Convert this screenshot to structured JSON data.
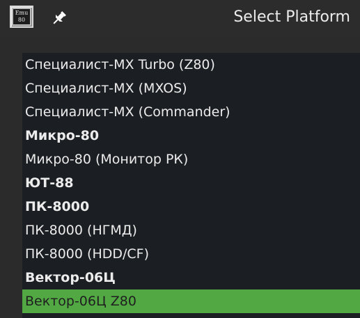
{
  "window": {
    "title": "Select Platform",
    "app_icon_text_line1": "Emu",
    "app_icon_text_line2": "80"
  },
  "colors": {
    "background": "#2b2b2b",
    "list_background": "#1b1e22",
    "selection": "#52a944",
    "text": "#ececec"
  },
  "icons": {
    "app": "emu80-app-icon",
    "pin": "pin-icon"
  },
  "list": {
    "items": [
      {
        "label": "Специалист-MX Turbo (Z80)",
        "bold": false,
        "selected": false
      },
      {
        "label": "Специалист-MX (MXOS)",
        "bold": false,
        "selected": false
      },
      {
        "label": "Специалист-MX (Commander)",
        "bold": false,
        "selected": false
      },
      {
        "label": "Микро-80",
        "bold": true,
        "selected": false
      },
      {
        "label": "Микро-80 (Монитор РК)",
        "bold": false,
        "selected": false
      },
      {
        "label": "ЮТ-88",
        "bold": true,
        "selected": false
      },
      {
        "label": "ПК-8000",
        "bold": true,
        "selected": false
      },
      {
        "label": "ПК-8000 (НГМД)",
        "bold": false,
        "selected": false
      },
      {
        "label": "ПК-8000 (HDD/CF)",
        "bold": false,
        "selected": false
      },
      {
        "label": "Вектор-06Ц",
        "bold": true,
        "selected": false
      },
      {
        "label": "Вектор-06Ц Z80",
        "bold": false,
        "selected": true
      }
    ]
  }
}
